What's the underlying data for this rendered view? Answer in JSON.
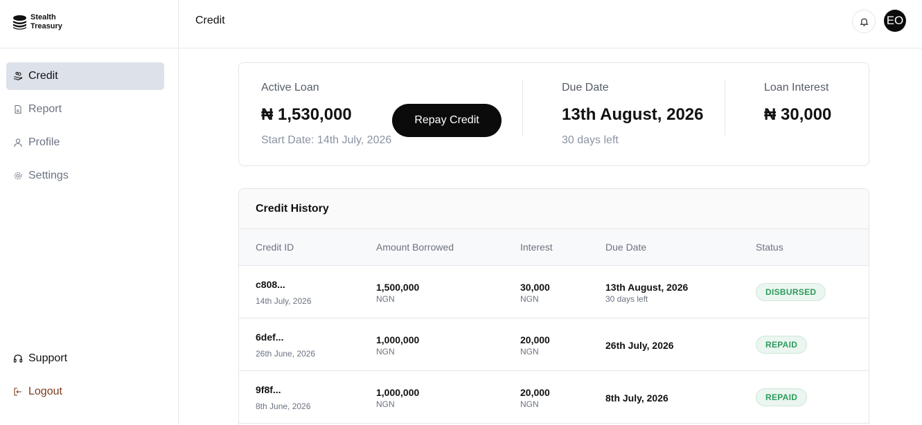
{
  "brand": {
    "line1": "Stealth",
    "line2": "Treasury"
  },
  "sidebar": {
    "items": [
      {
        "label": "Credit"
      },
      {
        "label": "Report"
      },
      {
        "label": "Profile"
      },
      {
        "label": "Settings"
      }
    ],
    "support_label": "Support",
    "logout_label": "Logout"
  },
  "header": {
    "title": "Credit",
    "avatar_initials": "EO"
  },
  "summary": {
    "active_loan_label": "Active Loan",
    "active_loan_value": "₦ 1,530,000",
    "start_date": "Start Date: 14th July, 2026",
    "repay_label": "Repay Credit",
    "due_date_label": "Due Date",
    "due_date_value": "13th August, 2026",
    "days_left": "30 days left",
    "interest_label": "Loan Interest",
    "interest_value": "₦ 30,000"
  },
  "history": {
    "title": "Credit History",
    "columns": [
      "Credit ID",
      "Amount Borrowed",
      "Interest",
      "Due Date",
      "Status"
    ],
    "rows": [
      {
        "id": "c808...",
        "date": "14th July, 2026",
        "amount": "1,500,000",
        "amount_cur": "NGN",
        "interest": "30,000",
        "interest_cur": "NGN",
        "due": "13th August, 2026",
        "due_sub": "30 days left",
        "status": "DISBURSED"
      },
      {
        "id": "6def...",
        "date": "26th June, 2026",
        "amount": "1,000,000",
        "amount_cur": "NGN",
        "interest": "20,000",
        "interest_cur": "NGN",
        "due": "26th July, 2026",
        "due_sub": "",
        "status": "REPAID"
      },
      {
        "id": "9f8f...",
        "date": "8th June, 2026",
        "amount": "1,000,000",
        "amount_cur": "NGN",
        "interest": "20,000",
        "interest_cur": "NGN",
        "due": "8th July, 2026",
        "due_sub": "",
        "status": "REPAID"
      }
    ]
  },
  "colors": {
    "accent_dark": "#0b0b0b",
    "active_nav": "#dde2ea",
    "status_green": "#2e9b5c",
    "logout": "#7a3b1e"
  }
}
